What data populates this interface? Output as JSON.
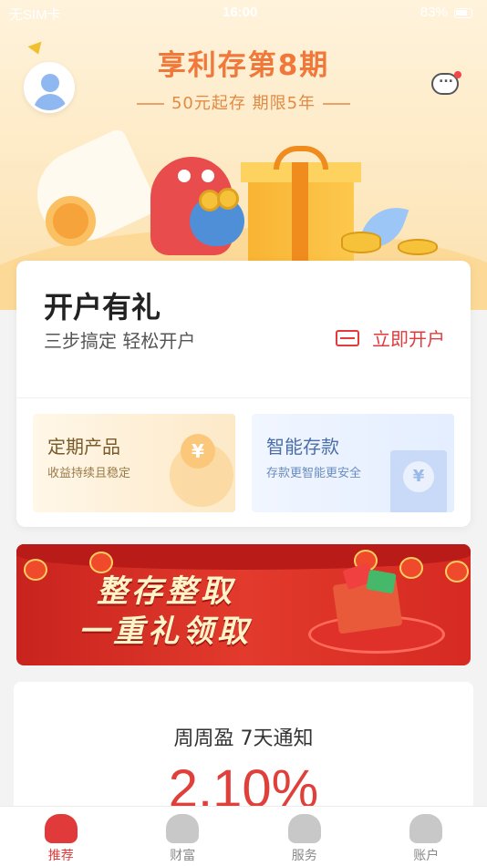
{
  "status_bar": {
    "carrier": "无SIM卡",
    "time": "16:00",
    "battery": "83%"
  },
  "hero": {
    "title": "享利存第8期",
    "subtitle": "50元起存   期限5年",
    "avatar_icon": "user-avatar-icon",
    "message_icon": "chat-bubble-icon"
  },
  "open_account": {
    "title": "开户有礼",
    "subtitle": "三步搞定 轻松开户",
    "button_label": "立即开户",
    "button_icon": "bank-card-icon",
    "accent": "#e33b3b"
  },
  "tiles": [
    {
      "title": "定期产品",
      "desc": "收益持续且稳定",
      "icon": "piggy-bank-icon",
      "symbol": "¥"
    },
    {
      "title": "智能存款",
      "desc": "存款更智能更安全",
      "icon": "atm-icon",
      "symbol": "¥"
    }
  ],
  "banner": {
    "line1": "整存整取",
    "line2": "一重礼领取"
  },
  "product": {
    "name": "周周盈  7天通知",
    "rate": "2.10%"
  },
  "tabbar": {
    "items": [
      {
        "label": "推荐",
        "icon": "dinosaur-home-icon",
        "active": true
      },
      {
        "label": "财富",
        "icon": "wealth-mascot-icon",
        "active": false
      },
      {
        "label": "服务",
        "icon": "service-mascot-icon",
        "active": false
      },
      {
        "label": "账户",
        "icon": "account-mascot-icon",
        "active": false
      }
    ],
    "active_color": "#e03a3a"
  }
}
